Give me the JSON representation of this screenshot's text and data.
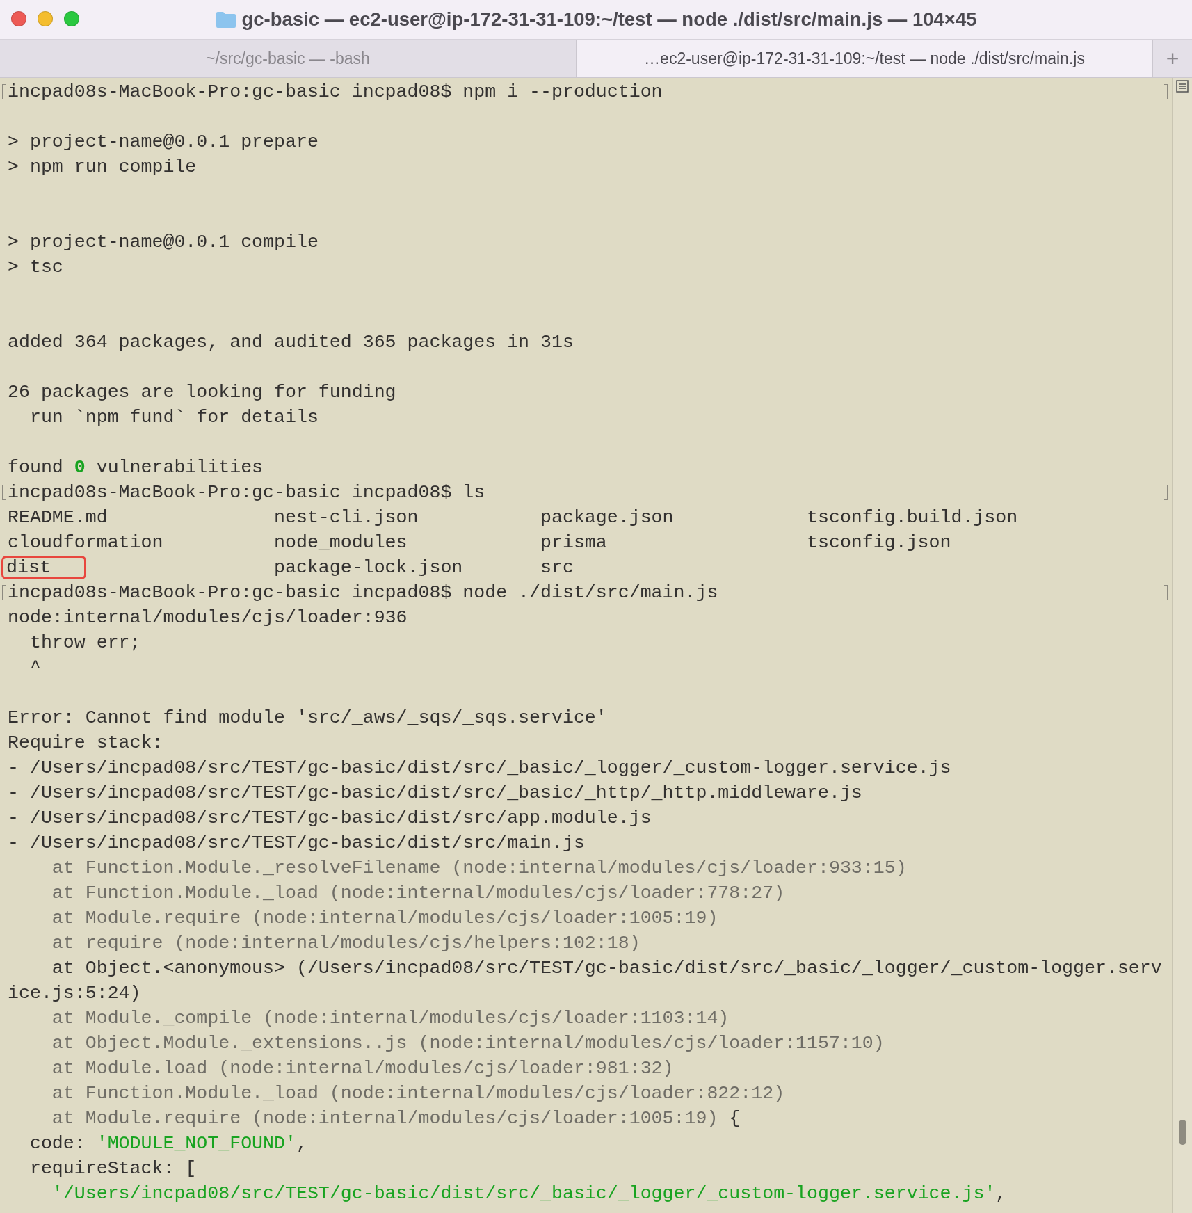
{
  "window": {
    "title": "gc-basic — ec2-user@ip-172-31-31-109:~/test — node ./dist/src/main.js — 104×45"
  },
  "tabs": [
    {
      "label": "~/src/gc-basic — -bash",
      "selected": false
    },
    {
      "label": "…ec2-user@ip-172-31-31-109:~/test — node ./dist/src/main.js",
      "selected": true
    }
  ],
  "new_tab_button": {
    "label": "+"
  },
  "terminal": {
    "lines": [
      {
        "kind": "text",
        "marked": true,
        "segments": [
          {
            "text": "incpad08s-MacBook-Pro:gc-basic incpad08$ npm i --production",
            "kind": "plain"
          }
        ]
      },
      {
        "kind": "blank"
      },
      {
        "kind": "text",
        "marked": false,
        "segments": [
          {
            "text": "> project-name@0.0.1 prepare",
            "kind": "plain"
          }
        ]
      },
      {
        "kind": "text",
        "marked": false,
        "segments": [
          {
            "text": "> npm run compile",
            "kind": "plain"
          }
        ]
      },
      {
        "kind": "blank"
      },
      {
        "kind": "blank"
      },
      {
        "kind": "text",
        "marked": false,
        "segments": [
          {
            "text": "> project-name@0.0.1 compile",
            "kind": "plain"
          }
        ]
      },
      {
        "kind": "text",
        "marked": false,
        "segments": [
          {
            "text": "> tsc",
            "kind": "plain"
          }
        ]
      },
      {
        "kind": "blank"
      },
      {
        "kind": "blank"
      },
      {
        "kind": "text",
        "marked": false,
        "segments": [
          {
            "text": "added 364 packages, and audited 365 packages in 31s",
            "kind": "plain"
          }
        ]
      },
      {
        "kind": "blank"
      },
      {
        "kind": "text",
        "marked": false,
        "segments": [
          {
            "text": "26 packages are looking for funding",
            "kind": "plain"
          }
        ]
      },
      {
        "kind": "text",
        "marked": false,
        "segments": [
          {
            "text": "  run `npm fund` for details",
            "kind": "plain"
          }
        ]
      },
      {
        "kind": "blank"
      },
      {
        "kind": "text",
        "marked": false,
        "segments": [
          {
            "text": "found ",
            "kind": "plain"
          },
          {
            "text": "0",
            "kind": "count"
          },
          {
            "text": " vulnerabilities",
            "kind": "plain"
          }
        ]
      },
      {
        "kind": "text",
        "marked": true,
        "segments": [
          {
            "text": "incpad08s-MacBook-Pro:gc-basic incpad08$ ls",
            "kind": "plain"
          }
        ]
      },
      {
        "kind": "columns",
        "cells": [
          {
            "text": "README.md",
            "highlighted": false
          },
          {
            "text": "nest-cli.json",
            "highlighted": false
          },
          {
            "text": "package.json",
            "highlighted": false
          },
          {
            "text": "tsconfig.build.json",
            "highlighted": false
          }
        ]
      },
      {
        "kind": "columns",
        "cells": [
          {
            "text": "cloudformation",
            "highlighted": false
          },
          {
            "text": "node_modules",
            "highlighted": false
          },
          {
            "text": "prisma",
            "highlighted": false
          },
          {
            "text": "tsconfig.json",
            "highlighted": false
          }
        ]
      },
      {
        "kind": "columns",
        "cells": [
          {
            "text": "dist",
            "highlighted": true
          },
          {
            "text": "package-lock.json",
            "highlighted": false
          },
          {
            "text": "src",
            "highlighted": false
          }
        ]
      },
      {
        "kind": "text",
        "marked": true,
        "segments": [
          {
            "text": "incpad08s-MacBook-Pro:gc-basic incpad08$ node ./dist/src/main.js",
            "kind": "plain"
          }
        ]
      },
      {
        "kind": "text",
        "marked": false,
        "segments": [
          {
            "text": "node:internal/modules/cjs/loader:936",
            "kind": "plain"
          }
        ]
      },
      {
        "kind": "text",
        "marked": false,
        "segments": [
          {
            "text": "  throw err;",
            "kind": "plain"
          }
        ]
      },
      {
        "kind": "text",
        "marked": false,
        "segments": [
          {
            "text": "  ^",
            "kind": "plain"
          }
        ]
      },
      {
        "kind": "blank"
      },
      {
        "kind": "text",
        "marked": false,
        "segments": [
          {
            "text": "Error: Cannot find module 'src/_aws/_sqs/_sqs.service'",
            "kind": "plain"
          }
        ]
      },
      {
        "kind": "text",
        "marked": false,
        "segments": [
          {
            "text": "Require stack:",
            "kind": "plain"
          }
        ]
      },
      {
        "kind": "text",
        "marked": false,
        "segments": [
          {
            "text": "- /Users/incpad08/src/TEST/gc-basic/dist/src/_basic/_logger/_custom-logger.service.js",
            "kind": "plain"
          }
        ]
      },
      {
        "kind": "text",
        "marked": false,
        "segments": [
          {
            "text": "- /Users/incpad08/src/TEST/gc-basic/dist/src/_basic/_http/_http.middleware.js",
            "kind": "plain"
          }
        ]
      },
      {
        "kind": "text",
        "marked": false,
        "segments": [
          {
            "text": "- /Users/incpad08/src/TEST/gc-basic/dist/src/app.module.js",
            "kind": "plain"
          }
        ]
      },
      {
        "kind": "text",
        "marked": false,
        "segments": [
          {
            "text": "- /Users/incpad08/src/TEST/gc-basic/dist/src/main.js",
            "kind": "plain"
          }
        ]
      },
      {
        "kind": "text",
        "marked": false,
        "segments": [
          {
            "text": "    at Function.Module._resolveFilename (node:internal/modules/cjs/loader:933:15)",
            "kind": "grey"
          }
        ]
      },
      {
        "kind": "text",
        "marked": false,
        "segments": [
          {
            "text": "    at Function.Module._load (node:internal/modules/cjs/loader:778:27)",
            "kind": "grey"
          }
        ]
      },
      {
        "kind": "text",
        "marked": false,
        "segments": [
          {
            "text": "    at Module.require (node:internal/modules/cjs/loader:1005:19)",
            "kind": "grey"
          }
        ]
      },
      {
        "kind": "text",
        "marked": false,
        "segments": [
          {
            "text": "    at require (node:internal/modules/cjs/helpers:102:18)",
            "kind": "grey"
          }
        ]
      },
      {
        "kind": "text",
        "marked": false,
        "segments": [
          {
            "text": "    at Object.<anonymous> (/Users/incpad08/src/TEST/gc-basic/dist/src/_basic/_logger/_custom-logger.serv",
            "kind": "plain"
          }
        ]
      },
      {
        "kind": "text",
        "marked": false,
        "segments": [
          {
            "text": "ice.js:5:24)",
            "kind": "plain"
          }
        ]
      },
      {
        "kind": "text",
        "marked": false,
        "segments": [
          {
            "text": "    at Module._compile (node:internal/modules/cjs/loader:1103:14)",
            "kind": "grey"
          }
        ]
      },
      {
        "kind": "text",
        "marked": false,
        "segments": [
          {
            "text": "    at Object.Module._extensions..js (node:internal/modules/cjs/loader:1157:10)",
            "kind": "grey"
          }
        ]
      },
      {
        "kind": "text",
        "marked": false,
        "segments": [
          {
            "text": "    at Module.load (node:internal/modules/cjs/loader:981:32)",
            "kind": "grey"
          }
        ]
      },
      {
        "kind": "text",
        "marked": false,
        "segments": [
          {
            "text": "    at Function.Module._load (node:internal/modules/cjs/loader:822:12)",
            "kind": "grey"
          }
        ]
      },
      {
        "kind": "text",
        "marked": false,
        "segments": [
          {
            "text": "    at Module.require (node:internal/modules/cjs/loader:1005:19)",
            "kind": "grey"
          },
          {
            "text": " {",
            "kind": "plain"
          }
        ]
      },
      {
        "kind": "text",
        "marked": false,
        "segments": [
          {
            "text": "  code: ",
            "kind": "plain"
          },
          {
            "text": "'MODULE_NOT_FOUND'",
            "kind": "green"
          },
          {
            "text": ",",
            "kind": "plain"
          }
        ]
      },
      {
        "kind": "text",
        "marked": false,
        "segments": [
          {
            "text": "  requireStack: [",
            "kind": "plain"
          }
        ]
      },
      {
        "kind": "text",
        "marked": false,
        "segments": [
          {
            "text": "    '/Users/incpad08/src/TEST/gc-basic/dist/src/_basic/_logger/_custom-logger.service.js'",
            "kind": "green"
          },
          {
            "text": ",",
            "kind": "plain"
          }
        ]
      }
    ]
  }
}
